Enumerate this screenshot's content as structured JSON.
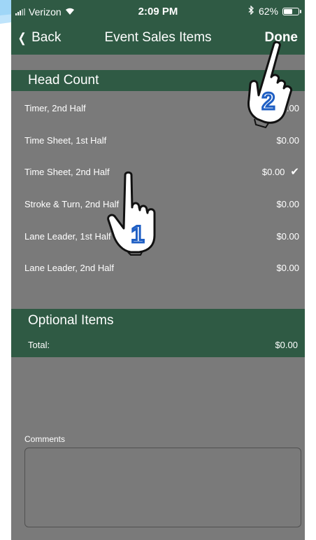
{
  "status_bar": {
    "carrier": "Verizon",
    "time": "2:09 PM",
    "battery": "62%",
    "battery_level": 0.62
  },
  "nav": {
    "back_label": "Back",
    "title": "Event Sales Items",
    "done_label": "Done"
  },
  "sections": {
    "head_count": "Head Count",
    "optional_items": "Optional Items"
  },
  "items": [
    {
      "name": "Timer, 2nd Half",
      "price": "$0.00",
      "selected": false
    },
    {
      "name": "Time Sheet, 1st Half",
      "price": "$0.00",
      "selected": false
    },
    {
      "name": "Time Sheet, 2nd Half",
      "price": "$0.00",
      "selected": true
    },
    {
      "name": "Stroke & Turn, 2nd Half",
      "price": "$0.00",
      "selected": false
    },
    {
      "name": "Lane Leader, 1st Half",
      "price": "$0.00",
      "selected": false
    },
    {
      "name": "Lane Leader, 2nd Half",
      "price": "$0.00",
      "selected": false
    }
  ],
  "total": {
    "label": "Total:",
    "value": "$0.00"
  },
  "comments": {
    "label": "Comments",
    "value": ""
  },
  "annotations": {
    "step1": "1",
    "step2": "2"
  },
  "colors": {
    "header_green": "#2f5a44",
    "background_gray": "#7a7a7a",
    "annotation_blue": "#1f5fc4"
  },
  "icons": {
    "back": "chevron-left-icon",
    "selected": "checkmark-icon",
    "pointer": "pointing-hand-icon"
  }
}
